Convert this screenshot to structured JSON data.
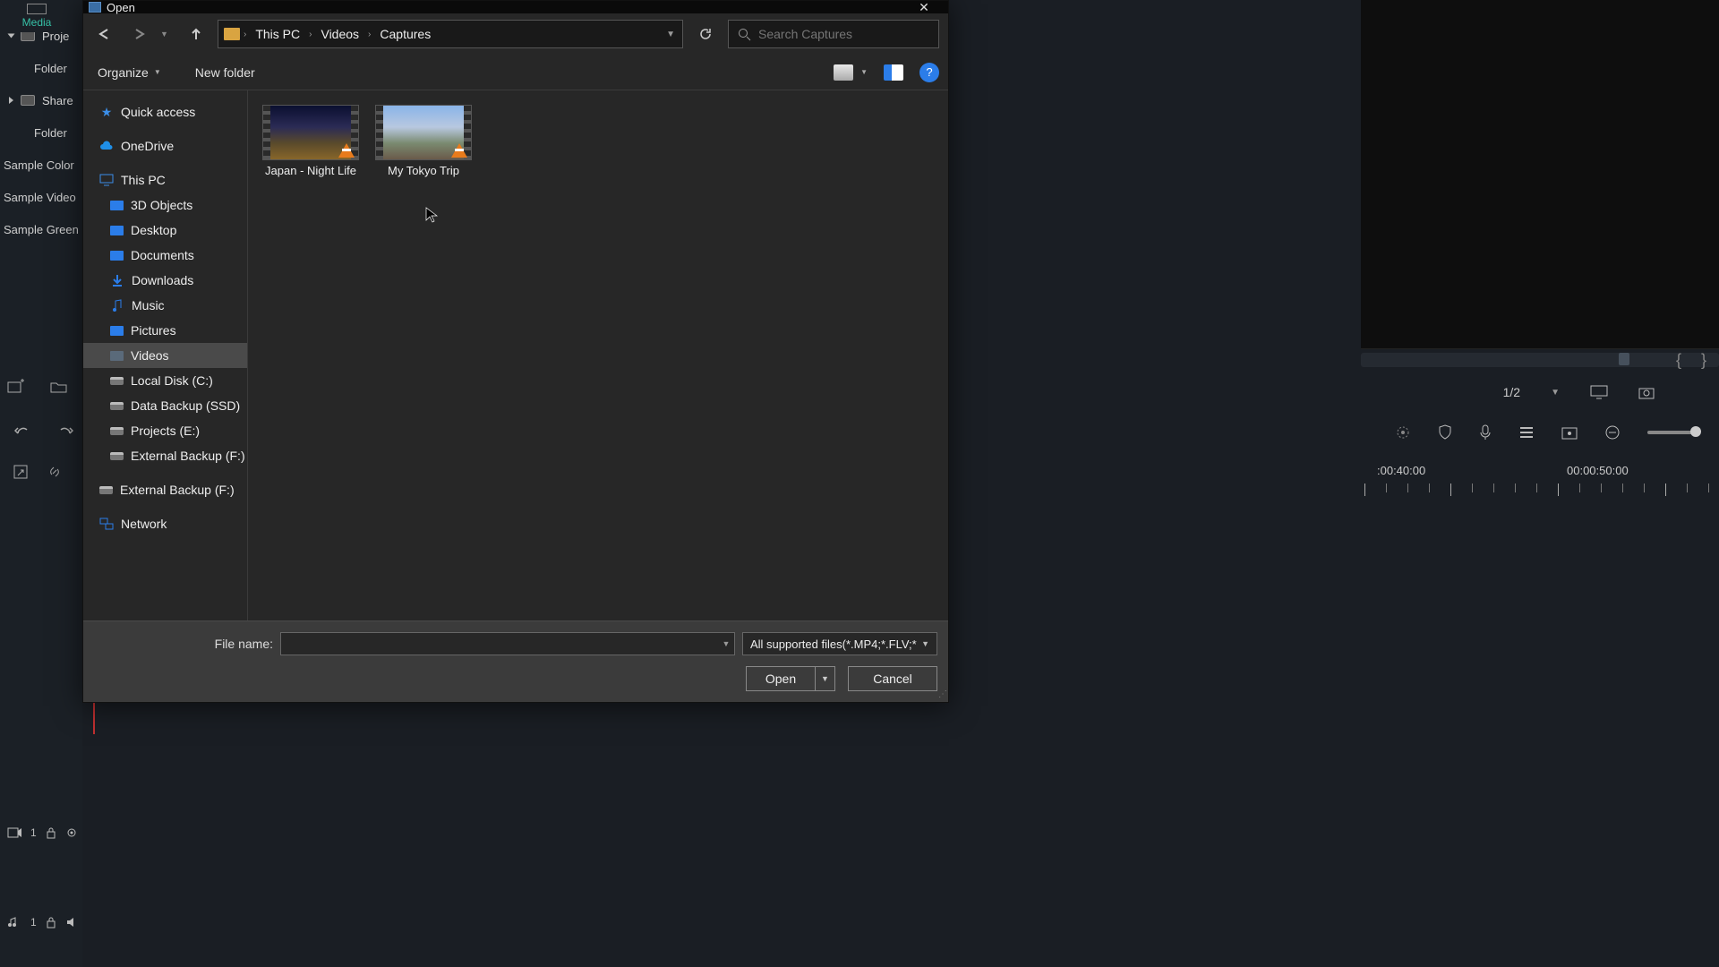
{
  "dialog": {
    "title": "Open",
    "breadcrumb": [
      "This PC",
      "Videos",
      "Captures"
    ],
    "search_placeholder": "Search Captures",
    "organize_label": "Organize",
    "newfolder_label": "New folder",
    "help_glyph": "?",
    "filename_label": "File name:",
    "filename_value": "",
    "filter_label": "All supported files(*.MP4;*.FLV;*",
    "open_label": "Open",
    "cancel_label": "Cancel"
  },
  "tree": {
    "quick_access": "Quick access",
    "onedrive": "OneDrive",
    "this_pc": "This PC",
    "items": [
      {
        "label": "3D Objects"
      },
      {
        "label": "Desktop"
      },
      {
        "label": "Documents"
      },
      {
        "label": "Downloads"
      },
      {
        "label": "Music"
      },
      {
        "label": "Pictures"
      },
      {
        "label": "Videos",
        "selected": true
      },
      {
        "label": "Local Disk (C:)"
      },
      {
        "label": "Data Backup (SSD)"
      },
      {
        "label": "Projects (E:)"
      },
      {
        "label": "External Backup (F:)"
      }
    ],
    "external_backup2": "External Backup (F:)",
    "network": "Network"
  },
  "files": [
    {
      "name": "Japan - Night Life",
      "thumb": "night"
    },
    {
      "name": "My Tokyo Trip",
      "thumb": "day"
    }
  ],
  "bg": {
    "media_tab": "Media",
    "proj_row": "Proje",
    "folder_label": "Folder",
    "shared_row": "Share",
    "rows": [
      "Sample Color",
      "Sample Video",
      "Sample Green"
    ],
    "track_v": "1",
    "track_a": "1",
    "page_label": "1/2",
    "tc1": ":00:40:00",
    "tc2": "00:00:50:00"
  }
}
